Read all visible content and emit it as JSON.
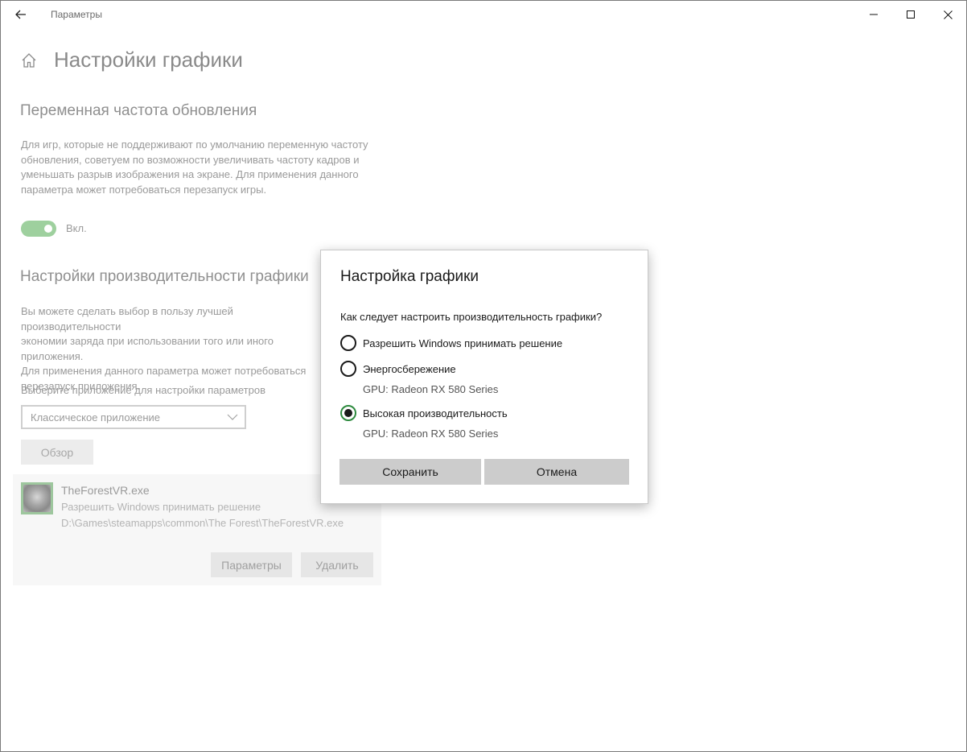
{
  "window": {
    "title": "Параметры"
  },
  "page": {
    "title": "Настройки графики",
    "vrr": {
      "title": "Переменная частота обновления",
      "description": "Для игр, которые не поддерживают по умолчанию переменную частоту обновления, советуем по возможности увеличивать частоту кадров и уменьшать разрыв изображения на экране. Для применения данного параметра может потребоваться перезапуск игры.",
      "toggle_state": "Вкл."
    },
    "perf": {
      "title": "Настройки производительности графики",
      "description": "Вы можете сделать выбор в пользу лучшей производительности\nэкономии заряда при использовании того или иного приложения.\nДля применения данного параметра может потребоваться\nперезапуск приложения.",
      "select_label": "Выберите приложение для настройки параметров",
      "dropdown_value": "Классическое приложение",
      "browse_label": "Обзор"
    },
    "app": {
      "name": "TheForestVR.exe",
      "mode": "Разрешить Windows принимать решение",
      "path": "D:\\Games\\steamapps\\common\\The Forest\\TheForestVR.exe",
      "params_label": "Параметры",
      "delete_label": "Удалить"
    }
  },
  "dialog": {
    "title": "Настройка графики",
    "question": "Как следует настроить производительность графики?",
    "options": [
      {
        "label": "Разрешить Windows принимать решение",
        "gpu": "",
        "checked": false
      },
      {
        "label": "Энергосбережение",
        "gpu": "GPU: Radeon RX 580 Series",
        "checked": false
      },
      {
        "label": "Высокая производительность",
        "gpu": "GPU: Radeon RX 580 Series",
        "checked": true
      }
    ],
    "save_label": "Сохранить",
    "cancel_label": "Отмена"
  },
  "colors": {
    "toggle_on": "#9ed09e",
    "radio_selected_ring": "#2d8a3e",
    "button_bg": "#cccccc"
  }
}
